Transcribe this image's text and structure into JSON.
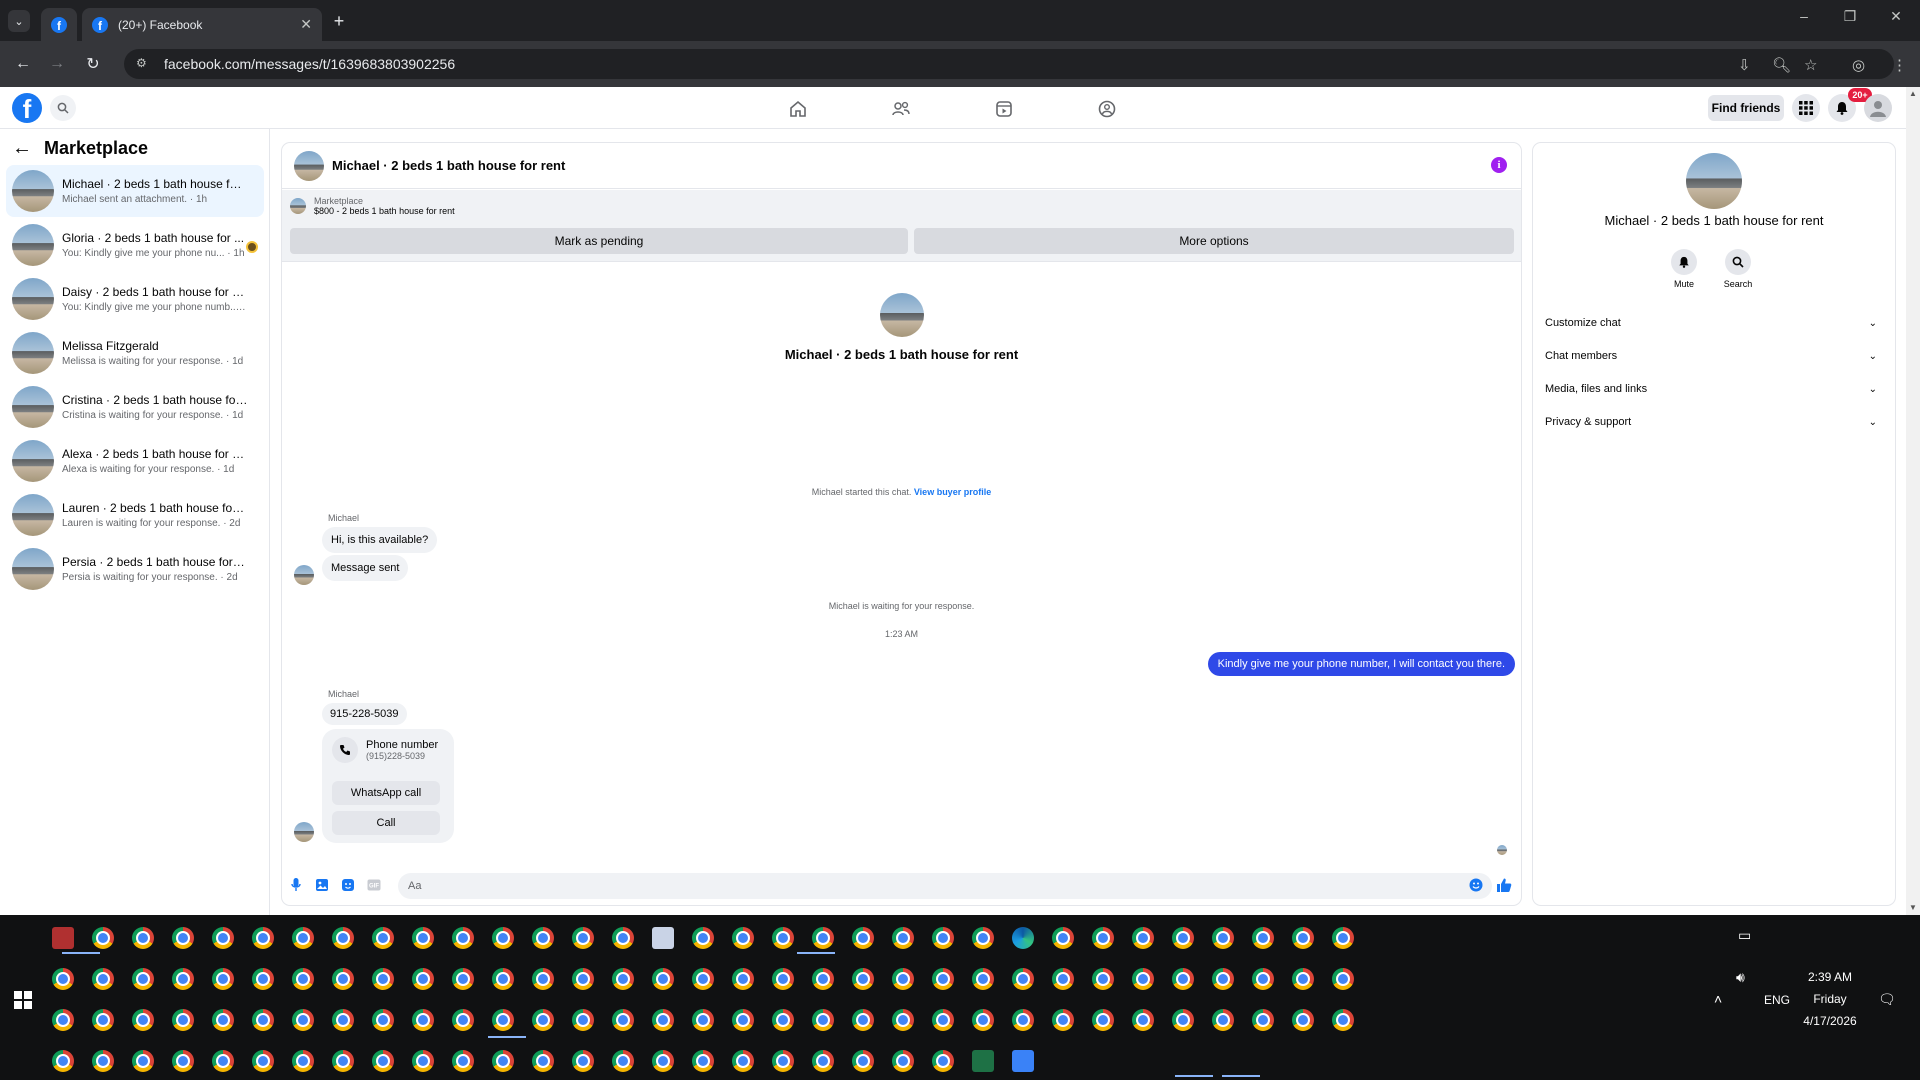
{
  "browser": {
    "tab_title": "(20+) Facebook",
    "url": "facebook.com/messages/t/1639683803902256",
    "new_tab_label": "+",
    "tab_close_label": "✕"
  },
  "fb_nav": {
    "find_friends": "Find friends",
    "notification_badge": "20+"
  },
  "left_panel": {
    "title": "Marketplace",
    "conversations": [
      {
        "name": "Michael · 2 beds 1 bath house for r...",
        "preview": "Michael sent an attachment. · 1h"
      },
      {
        "name": "Gloria · 2 beds 1 bath house for ...",
        "preview": "You: Kindly give me your phone nu... · 1h"
      },
      {
        "name": "Daisy · 2 beds 1 bath house for rent",
        "preview": "You: Kindly give me your phone numb... · 1h"
      },
      {
        "name": "Melissa Fitzgerald",
        "preview": "Melissa is waiting for your response. · 1d"
      },
      {
        "name": "Cristina · 2 beds 1 bath house for r...",
        "preview": "Cristina is waiting for your response. · 1d"
      },
      {
        "name": "Alexa · 2 beds 1 bath house for rent",
        "preview": "Alexa is waiting for your response. · 1d"
      },
      {
        "name": "Lauren · 2 beds 1 bath house for re...",
        "preview": "Lauren is waiting for your response. · 2d"
      },
      {
        "name": "Persia · 2 beds 1 bath house for rent",
        "preview": "Persia is waiting for your response. · 2d"
      }
    ]
  },
  "chat": {
    "title": "Michael · 2 beds 1 bath house for rent",
    "marketplace_label": "Marketplace",
    "listing": "$800 - 2 beds 1 bath house for rent",
    "mark_pending": "Mark as pending",
    "more_options": "More options",
    "profile_name": "Michael · 2 beds 1 bath house for rent",
    "started_text": "Michael started this chat.",
    "view_buyer_profile": "View buyer profile",
    "sender": "Michael",
    "msg1": "Hi, is this available?",
    "msg2": "Message sent",
    "waiting": "Michael is waiting for your response.",
    "time": "1:23 AM",
    "outgoing": "Kindly give me your phone number, I will contact you there.",
    "sender2": "Michael",
    "phone_msg": "915-228-5039",
    "card_title": "Phone number",
    "card_number": "(915)228-5039",
    "whatsapp_call": "WhatsApp call",
    "call": "Call",
    "composer_placeholder": "Aa"
  },
  "right_panel": {
    "name": "Michael · 2 beds 1 bath house for rent",
    "mute": "Mute",
    "search": "Search",
    "items": [
      "Customize chat",
      "Chat members",
      "Media, files and links",
      "Privacy & support"
    ]
  },
  "taskbar": {
    "time": "2:39 AM",
    "day": "Friday",
    "date": "4/17/2026",
    "lang": "ENG"
  },
  "colors": {
    "fb_blue": "#1877f2",
    "outgoing_bubble": "#2f49e8",
    "badge_red": "#e41e3f",
    "info_purple": "#a020f0"
  }
}
